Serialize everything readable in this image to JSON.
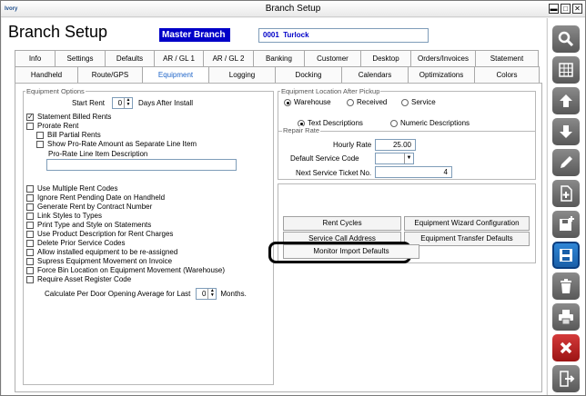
{
  "window": {
    "app_icon_text": "Ivory",
    "title": "Branch Setup",
    "minimize": "▬",
    "maximize": "□",
    "close": "✕"
  },
  "header": {
    "app_title": "Branch Setup",
    "branch_name": "Master Branch",
    "branch_code": "0001",
    "branch_city": "Turlock"
  },
  "tabs_row1": [
    "Info",
    "Settings",
    "Defaults",
    "AR / GL 1",
    "AR / GL 2",
    "Banking",
    "Customer",
    "Desktop",
    "Orders/Invoices",
    "Statement"
  ],
  "tabs_row2": [
    "Handheld",
    "Route/GPS",
    "Equipment",
    "Logging",
    "Docking",
    "Calendars",
    "Optimizations",
    "Colors"
  ],
  "active_tab": "Equipment",
  "equipment_options": {
    "legend": "Equipment Options",
    "start_rent_label": "Start Rent",
    "start_rent_value": "0",
    "start_rent_suffix": "Days After Install",
    "statement_billed_rents": "Statement Billed Rents",
    "prorate_rent": "Prorate Rent",
    "bill_partial_rents": "Bill Partial Rents",
    "show_prorate": "Show Pro-Rate Amount as Separate Line Item",
    "prorate_desc_label": "Pro-Rate Line Item Description",
    "prorate_desc_value": "",
    "checks": [
      "Use Multiple Rent Codes",
      "Ignore Rent Pending Date on Handheld",
      "Generate Rent by Contract Number",
      "Link Styles to Types",
      "Print Type and Style on Statements",
      "Use Product Description for Rent Charges",
      "Delete Prior Service Codes",
      "Allow installed equipment to be re-assigned",
      "Supress Equipment Movement on Invoice",
      "Force Bin Location on Equipment Movement (Warehouse)",
      "Require Asset Register Code"
    ],
    "calc_label": "Calculate Per Door Opening Average for Last",
    "calc_value": "0",
    "calc_suffix": "Months."
  },
  "equipment_location": {
    "legend": "Equipment Location After Pickup",
    "options": [
      "Warehouse",
      "Received",
      "Service"
    ],
    "selected": "Warehouse"
  },
  "descriptions": {
    "options": [
      "Text Descriptions",
      "Numeric Descriptions"
    ],
    "selected": "Text Descriptions"
  },
  "repair_rate": {
    "legend": "Repair Rate",
    "hourly_rate_label": "Hourly Rate",
    "hourly_rate_value": "25.00",
    "default_service_code_label": "Default Service Code",
    "default_service_code_value": "",
    "next_ticket_label": "Next Service Ticket No.",
    "next_ticket_value": "4"
  },
  "buttons": {
    "rent_cycles": "Rent Cycles",
    "wizard_config": "Equipment Wizard Configuration",
    "service_call_address": "Service Call Address",
    "transfer_defaults": "Equipment Transfer Defaults",
    "monitor_import_defaults": "Monitor Import Defaults"
  },
  "colors": {
    "accent": "#1e64c8",
    "branch_bg": "#0000c8",
    "toolbar_save": "#1a5fa8",
    "toolbar_cancel": "#b01c1c"
  },
  "sidebar_icons": [
    "search-icon",
    "grid-icon",
    "arrow-up-icon",
    "arrow-down-icon",
    "pencil-icon",
    "add-document-icon",
    "save-new-icon",
    "save-icon",
    "trash-icon",
    "print-icon",
    "cancel-icon",
    "exit-icon"
  ]
}
